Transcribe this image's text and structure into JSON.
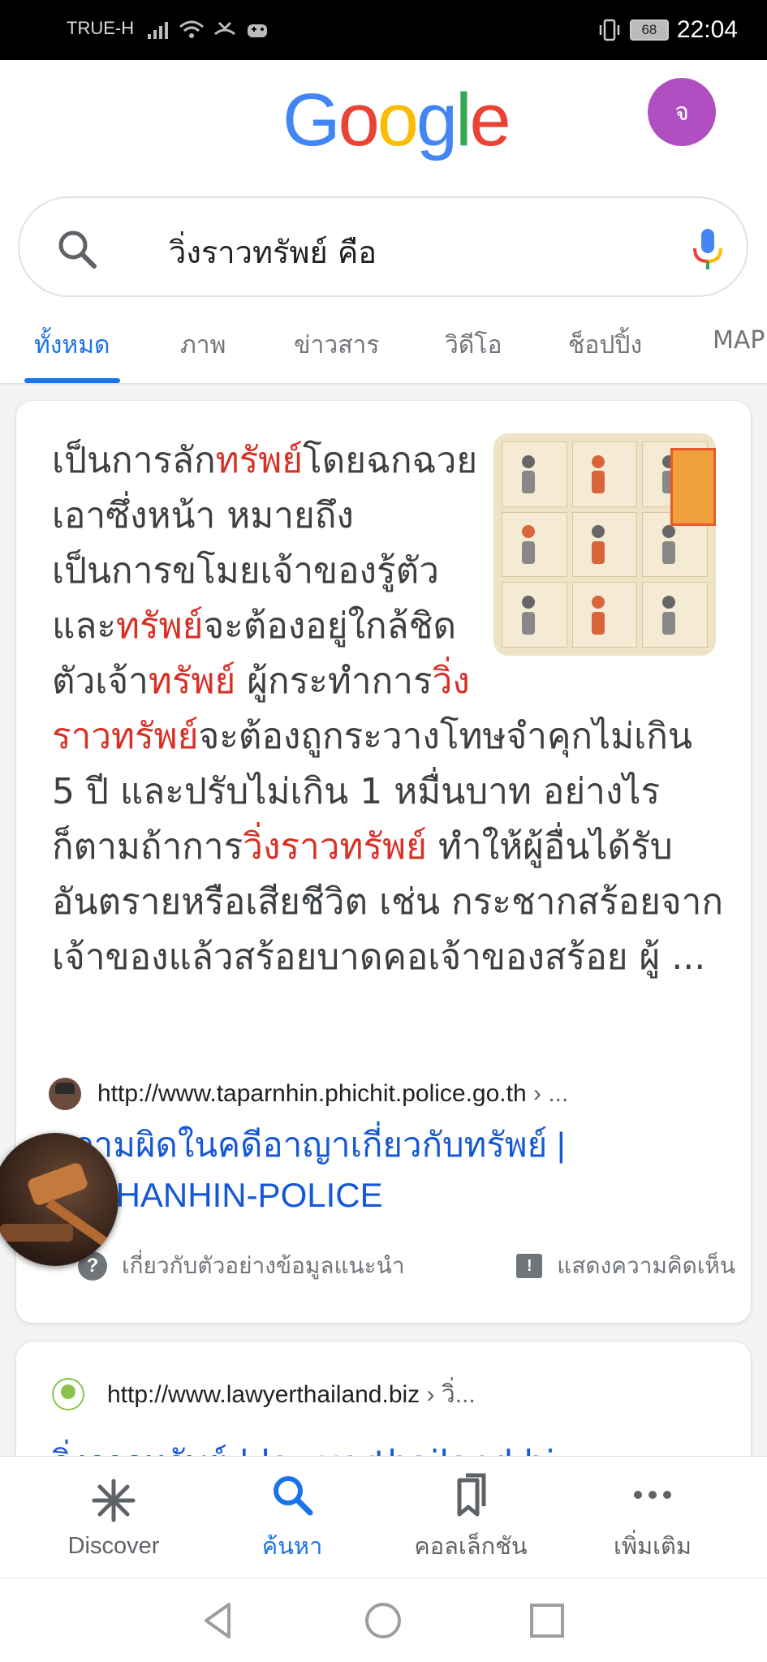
{
  "status_bar": {
    "carrier": "TRUE-H",
    "battery": "68",
    "time": "22:04"
  },
  "header": {
    "logo_letters": [
      "G",
      "o",
      "o",
      "g",
      "l",
      "e"
    ],
    "logo_colors": [
      "#4285F4",
      "#EA4335",
      "#FBBC05",
      "#4285F4",
      "#34A853",
      "#EA4335"
    ],
    "avatar_letter": "จ"
  },
  "search": {
    "query": "วิ่งราวทรัพย์ คือ"
  },
  "tabs": [
    {
      "label": "ทั้งหมด",
      "active": true
    },
    {
      "label": "ภาพ"
    },
    {
      "label": "ข่าวสาร"
    },
    {
      "label": "วิดีโอ"
    },
    {
      "label": "ช็อปปิ้ง"
    },
    {
      "label": "MAP"
    }
  ],
  "featured": {
    "snippet": [
      {
        "t": "เป็นการลัก"
      },
      {
        "t": "ทรัพย์",
        "hl": true
      },
      {
        "t": "โดย"
      },
      {
        "t": "ฉกฉวยเอาซึ่งหน้า หมายถึง เป็นการขโมยเจ้าของรู้ตัวและ"
      },
      {
        "t": "ทรัพย์",
        "hl": true
      },
      {
        "t": "จะต้องอยู่ใกล้ชิดตัวเจ้า"
      },
      {
        "t": "ทรัพย์",
        "hl": true
      },
      {
        "t": " ผู้กระทำการ"
      },
      {
        "t": "วิ่งราวทรัพย์",
        "hl": true
      },
      {
        "t": "จะต้องถูกระวางโทษจำคุกไม่เกิน 5 ปี และปรับไม่เกิน 1 หมื่นบาท อย่างไรก็ตามถ้าการ"
      },
      {
        "t": "วิ่งราวทรัพย์",
        "hl": true
      },
      {
        "t": " ทำให้ผู้อื่นได้รับอันตรายหรือเสียชีวิต เช่น กระชากสร้อยจากเจ้าของแล้วสร้อยบาดคอเจ้าของสร้อย ผู้ ..."
      }
    ],
    "source_url": "http://www.taparnhin.phichit.police.go.th",
    "source_tail": " › ...",
    "title": "ความผิดในคดีอาญาเกี่ยวกับทรัพย์ | TAPHANHIN-POLICE",
    "about_label": "เกี่ยวกับตัวอย่างข้อมูลแนะนำ",
    "feedback_label": "แสดงความคิดเห็น"
  },
  "result2": {
    "source_url": "http://www.lawyerthailand.biz",
    "source_tail": " › วิ่...",
    "title_peek": "วิ่งราวทรัพย์ | lawyerthailand.biz"
  },
  "bottom_nav": [
    {
      "label": "Discover",
      "icon": "asterisk-icon"
    },
    {
      "label": "ค้นหา",
      "icon": "search-icon",
      "active": true
    },
    {
      "label": "คอลเล็กชัน",
      "icon": "bookmarks-icon"
    },
    {
      "label": "เพิ่มเติม",
      "icon": "more-icon"
    }
  ],
  "accent": "#1a73e8",
  "highlight_color": "#d93025"
}
